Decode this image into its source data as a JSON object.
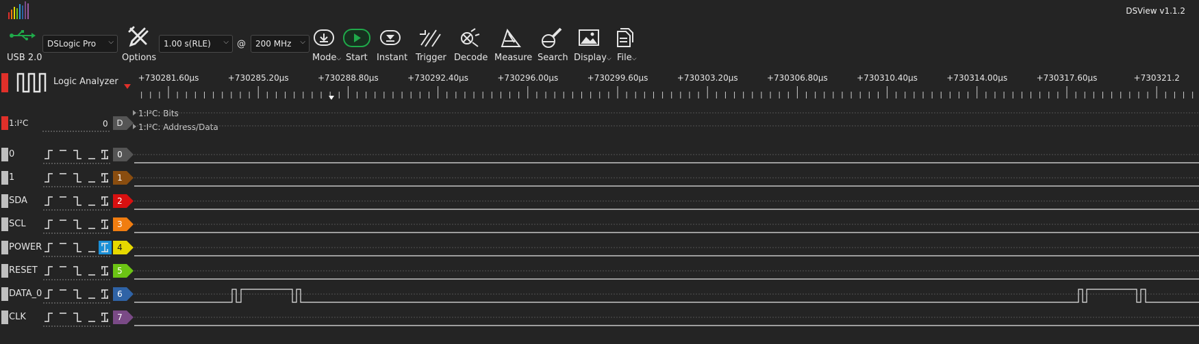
{
  "app": {
    "title": "DSView v1.1.2"
  },
  "toolbar": {
    "usb_label": "USB 2.0",
    "device_select": "DSLogic Pro",
    "options_label": "Options",
    "duration_select": "1.00 s(RLE)",
    "at_symbol": "@",
    "rate_select": "200 MHz",
    "buttons": [
      {
        "label": "Mode",
        "icon": "mode-download-icon",
        "has_dropdown": true
      },
      {
        "label": "Start",
        "icon": "start-play-icon",
        "has_dropdown": false
      },
      {
        "label": "Instant",
        "icon": "instant-icon",
        "has_dropdown": false
      },
      {
        "label": "Trigger",
        "icon": "trigger-icon",
        "has_dropdown": false
      },
      {
        "label": "Decode",
        "icon": "decode-icon",
        "has_dropdown": false
      },
      {
        "label": "Measure",
        "icon": "measure-icon",
        "has_dropdown": false
      },
      {
        "label": "Search",
        "icon": "search-icon",
        "has_dropdown": false
      },
      {
        "label": "Display",
        "icon": "display-icon",
        "has_dropdown": true
      },
      {
        "label": "File",
        "icon": "file-icon",
        "has_dropdown": true
      }
    ],
    "start_color": "#1faa4a"
  },
  "header": {
    "label": "Logic Analyzer"
  },
  "ruler": {
    "ticks": [
      "+730281.60μs",
      "+730285.20μs",
      "+730288.80μs",
      "+730292.40μs",
      "+730296.00μs",
      "+730299.60μs",
      "+730303.20μs",
      "+730306.80μs",
      "+730310.40μs",
      "+730314.00μs",
      "+730317.60μs",
      "+730321.2"
    ]
  },
  "decoder": {
    "name": "1:I²C",
    "value": "0",
    "tag": "D",
    "rows": [
      "1:I²C: Bits",
      "1:I²C: Address/Data"
    ],
    "color": "#e0302a"
  },
  "channels": [
    {
      "name": "0",
      "tag": "0",
      "color": "#555555",
      "selected_trigger": false
    },
    {
      "name": "1",
      "tag": "1",
      "color": "#8a4d0f",
      "selected_trigger": false
    },
    {
      "name": "SDA",
      "tag": "2",
      "color": "#d81010",
      "selected_trigger": false
    },
    {
      "name": "SCL",
      "tag": "3",
      "color": "#f07d10",
      "selected_trigger": false
    },
    {
      "name": "POWER",
      "tag": "4",
      "color": "#e6d800",
      "selected_trigger": true
    },
    {
      "name": "RESET",
      "tag": "5",
      "color": "#6cc414",
      "selected_trigger": false
    },
    {
      "name": "DATA_0",
      "tag": "6",
      "color": "#2f63a6",
      "selected_trigger": false
    },
    {
      "name": "CLK",
      "tag": "7",
      "color": "#7a4a86",
      "selected_trigger": false
    }
  ]
}
